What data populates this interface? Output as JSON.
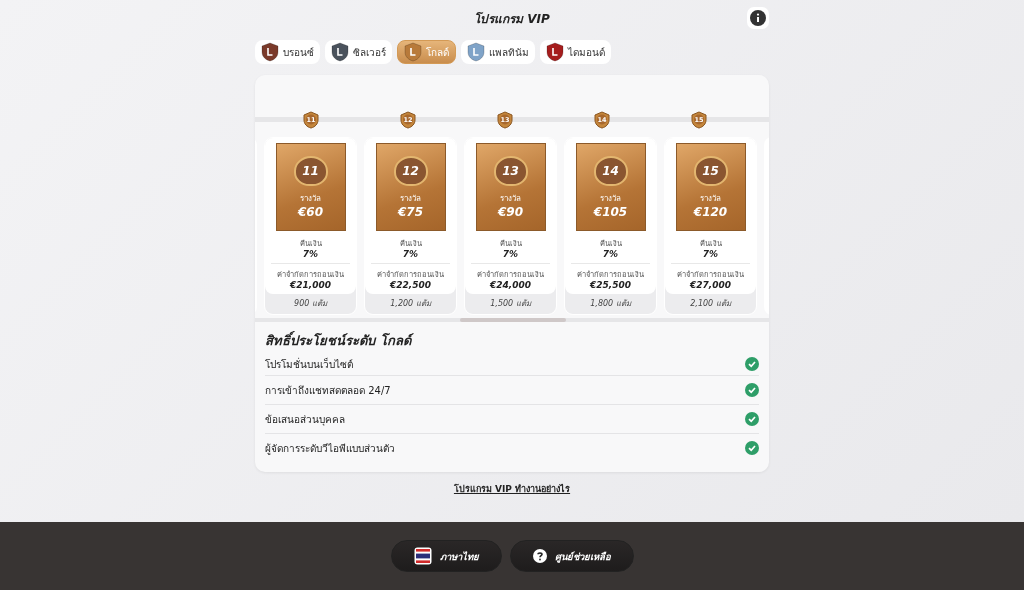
{
  "header": {
    "title": "โปรแกรม VIP"
  },
  "tabs": [
    {
      "label": "บรอนซ์",
      "selected": false,
      "color": "#7a3a2a"
    },
    {
      "label": "ซิลเวอร์",
      "selected": false,
      "color": "#4a525c"
    },
    {
      "label": "โกลด์",
      "selected": true,
      "color": "#b87a3a"
    },
    {
      "label": "แพลทินัม",
      "selected": false,
      "color": "#7fa3c8"
    },
    {
      "label": "ไดมอนด์",
      "selected": false,
      "color": "#a51d1d"
    }
  ],
  "timeline": [
    "11",
    "12",
    "13",
    "14",
    "15"
  ],
  "levels": [
    {
      "number": "11",
      "reward_label": "รางวัล",
      "reward": "€60",
      "cashback_label": "คืนเงิน",
      "cashback": "7%",
      "limit_label": "ค่าจำกัดการถอนเงิน",
      "limit": "€21,000",
      "points": "900 แต้ม"
    },
    {
      "number": "12",
      "reward_label": "รางวัล",
      "reward": "€75",
      "cashback_label": "คืนเงิน",
      "cashback": "7%",
      "limit_label": "ค่าจำกัดการถอนเงิน",
      "limit": "€22,500",
      "points": "1,200 แต้ม"
    },
    {
      "number": "13",
      "reward_label": "รางวัล",
      "reward": "€90",
      "cashback_label": "คืนเงิน",
      "cashback": "7%",
      "limit_label": "ค่าจำกัดการถอนเงิน",
      "limit": "€24,000",
      "points": "1,500 แต้ม"
    },
    {
      "number": "14",
      "reward_label": "รางวัล",
      "reward": "€105",
      "cashback_label": "คืนเงิน",
      "cashback": "7%",
      "limit_label": "ค่าจำกัดการถอนเงิน",
      "limit": "€25,500",
      "points": "1,800 แต้ม"
    },
    {
      "number": "15",
      "reward_label": "รางวัล",
      "reward": "€120",
      "cashback_label": "คืนเงิน",
      "cashback": "7%",
      "limit_label": "ค่าจำกัดการถอนเงิน",
      "limit": "€27,000",
      "points": "2,100 แต้ม"
    }
  ],
  "benefits": {
    "title": "สิทธิ์ประโยชน์ระดับ โกลด์",
    "items": [
      {
        "label": "โปรโมชั่นบนเว็บไซต์",
        "included": true
      },
      {
        "label": "การเข้าถึงแชทสดตลอด 24/7",
        "included": true
      },
      {
        "label": "ข้อเสนอส่วนบุคคล",
        "included": true
      },
      {
        "label": "ผู้จัดการระดับวีไอพีแบบส่วนตัว",
        "included": true
      }
    ]
  },
  "link": "โปรแกรม VIP ทำงานอย่างไร",
  "footer": {
    "language": "ภาษาไทย",
    "help": "ศูนย์ช่วยเหลือ"
  }
}
